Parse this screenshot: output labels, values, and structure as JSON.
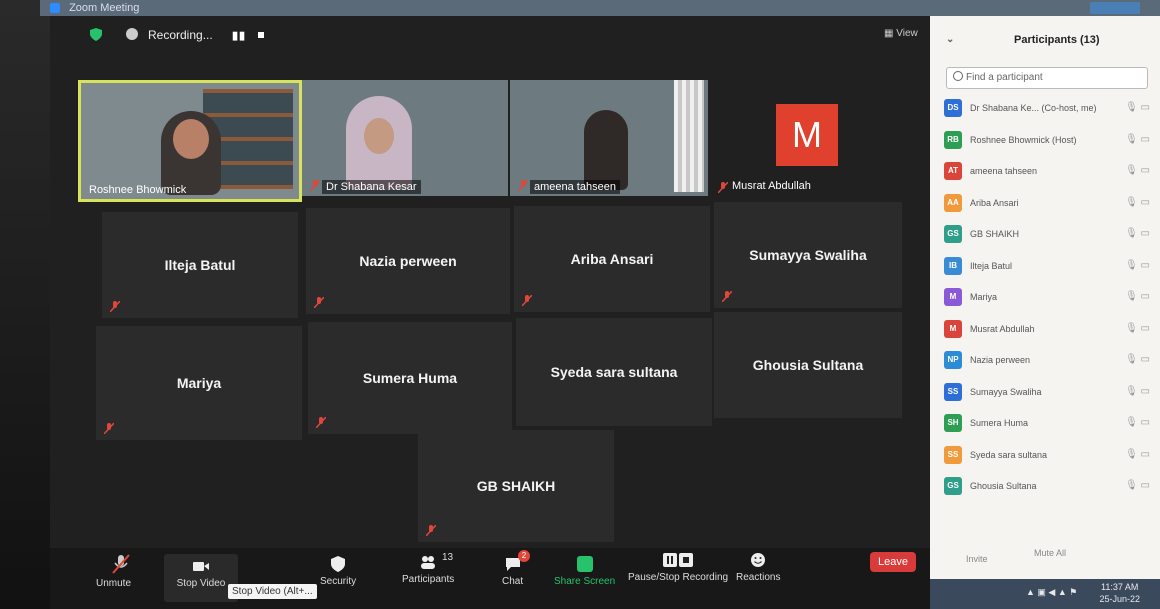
{
  "window": {
    "title": "Zoom Meeting"
  },
  "top_bar": {
    "recording_label": "Recording...",
    "view_label": "View"
  },
  "video_tiles": [
    {
      "name": "Roshnee Bhowmick"
    },
    {
      "name": "Dr Shabana Kesar"
    },
    {
      "name": "ameena tahseen"
    },
    {
      "name": "Musrat Abdullah",
      "avatar_letter": "M"
    }
  ],
  "name_tiles": [
    "Ilteja Batul",
    "Nazia perween",
    "Ariba Ansari",
    "Sumayya Swaliha",
    "Mariya",
    "Sumera Huma",
    "Syeda sara sultana",
    "Ghousia Sultana",
    "GB SHAIKH"
  ],
  "toolbar": {
    "unmute": "Unmute",
    "stop_video": "Stop Video",
    "tooltip": "Stop Video (Alt+...",
    "security": "Security",
    "participants": "Participants",
    "participants_count": "13",
    "chat": "Chat",
    "chat_badge": "2",
    "share_screen": "Share Screen",
    "pause_stop_recording": "Pause/Stop Recording",
    "reactions": "Reactions",
    "leave": "Leave"
  },
  "panel": {
    "title": "Participants (13)",
    "search_placeholder": "Find a participant",
    "participants": [
      {
        "initials": "DS",
        "name": "Dr Shabana Ke... (Co-host, me)",
        "color": "#2d6fd6"
      },
      {
        "initials": "RB",
        "name": "Roshnee Bhowmick (Host)",
        "color": "#2f9e55"
      },
      {
        "initials": "AT",
        "name": "ameena tahseen",
        "color": "#d9453b"
      },
      {
        "initials": "AA",
        "name": "Ariba Ansari",
        "color": "#f19a3c"
      },
      {
        "initials": "GS",
        "name": "GB SHAIKH",
        "color": "#2f9e8a"
      },
      {
        "initials": "IB",
        "name": "Ilteja Batul",
        "color": "#3a8bd6"
      },
      {
        "initials": "M",
        "name": "Mariya",
        "color": "#8a5ad6"
      },
      {
        "initials": "M",
        "name": "Musrat Abdullah",
        "color": "#d9453b"
      },
      {
        "initials": "NP",
        "name": "Nazia perween",
        "color": "#2d8cd6"
      },
      {
        "initials": "SS",
        "name": "Sumayya Swaliha",
        "color": "#2d6fd6"
      },
      {
        "initials": "SH",
        "name": "Sumera Huma",
        "color": "#2f9e55"
      },
      {
        "initials": "SS",
        "name": "Syeda sara sultana",
        "color": "#f19a3c"
      },
      {
        "initials": "GS",
        "name": "Ghousia Sultana",
        "color": "#2f9e8a"
      }
    ],
    "invite": "Invite",
    "mute_all": "Mute All"
  },
  "taskbar": {
    "time": "11:37 AM",
    "date": "25-Jun-22"
  }
}
